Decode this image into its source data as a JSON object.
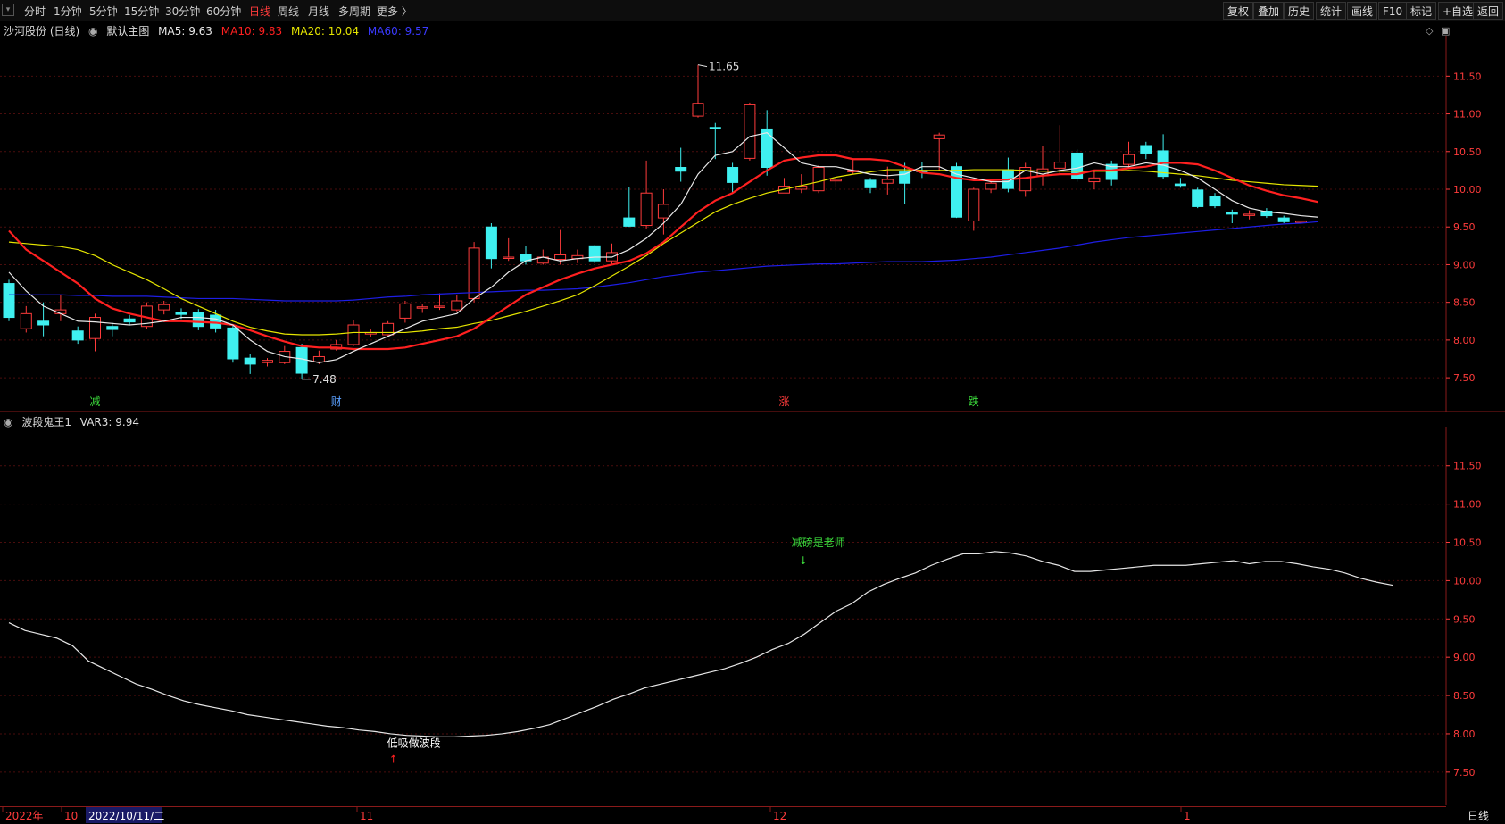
{
  "toolbar": {
    "periods": [
      "分时",
      "1分钟",
      "5分钟",
      "15分钟",
      "30分钟",
      "60分钟",
      "日线",
      "周线",
      "月线",
      "多周期",
      "更多 〉"
    ],
    "active_period": "日线",
    "actions": [
      "复权",
      "叠加",
      "历史",
      "统计",
      "画线",
      "F10",
      "标记",
      "+自选",
      "返回"
    ]
  },
  "main_legend": {
    "stock": "沙河股份 (日线)",
    "template": "默认主图",
    "ma5": "MA5: 9.63",
    "ma10": "MA10: 9.83",
    "ma20": "MA20: 10.04",
    "ma60": "MA60: 9.57"
  },
  "sub_legend": {
    "indicator": "波段鬼王1",
    "var3": "VAR3: 9.94"
  },
  "colors": {
    "up": "#ff3b3b",
    "down": "#3ff0f0",
    "ma5": "#e8e8e8",
    "ma10": "#ff2020",
    "ma20": "#e6e600",
    "ma60": "#1e1ee6",
    "axis": "#ff3b3b",
    "grid": "#4a0d0d"
  },
  "main_y_ticks": [
    "11.50",
    "11.00",
    "10.50",
    "10.00",
    "9.50",
    "9.00",
    "8.50",
    "8.00",
    "7.50"
  ],
  "sub_y_ticks": [
    "11.50",
    "11.00",
    "10.50",
    "10.00",
    "9.50",
    "9.00",
    "8.50",
    "8.00",
    "7.50"
  ],
  "annotations": {
    "high": "11.65",
    "low": "7.48"
  },
  "event_marks": [
    {
      "label": "减",
      "color": "#3cdc3c",
      "index": 5
    },
    {
      "label": "财",
      "color": "#5aa0ff",
      "index": 19
    },
    {
      "label": "涨",
      "color": "#ff3b3b",
      "index": 45
    },
    {
      "label": "跌",
      "color": "#3cdc3c",
      "index": 56
    }
  ],
  "sub_signals": {
    "buy": "低吸做波段",
    "sell": "减磅是老师"
  },
  "x_axis": {
    "year": "2022年",
    "m10": "10",
    "cursor_date": "2022/10/11/二",
    "m11": "11",
    "m12": "12",
    "m1": "1",
    "period": "日线"
  },
  "chart_data": {
    "type": "candlestick",
    "ylim": [
      7.3,
      11.8
    ],
    "candles": [
      [
        8.75,
        8.3,
        8.8,
        8.25
      ],
      [
        8.15,
        8.35,
        8.45,
        8.1
      ],
      [
        8.25,
        8.2,
        8.5,
        8.05
      ],
      [
        8.35,
        8.4,
        8.6,
        8.25
      ],
      [
        8.12,
        8.0,
        8.18,
        7.95
      ],
      [
        8.02,
        8.3,
        8.35,
        7.85
      ],
      [
        8.18,
        8.14,
        8.23,
        8.05
      ],
      [
        8.28,
        8.24,
        8.33,
        8.2
      ],
      [
        8.18,
        8.45,
        8.5,
        8.15
      ],
      [
        8.4,
        8.47,
        8.52,
        8.34
      ],
      [
        8.36,
        8.34,
        8.42,
        8.28
      ],
      [
        8.36,
        8.18,
        8.41,
        8.13
      ],
      [
        8.33,
        8.16,
        8.4,
        8.1
      ],
      [
        8.16,
        7.75,
        8.21,
        7.7
      ],
      [
        7.76,
        7.68,
        7.82,
        7.55
      ],
      [
        7.7,
        7.73,
        7.76,
        7.65
      ],
      [
        7.7,
        7.85,
        7.92,
        7.68
      ],
      [
        7.9,
        7.56,
        7.95,
        7.48
      ],
      [
        7.71,
        7.78,
        7.86,
        7.68
      ],
      [
        7.88,
        7.94,
        8.0,
        7.86
      ],
      [
        7.94,
        8.2,
        8.26,
        7.92
      ],
      [
        8.08,
        8.1,
        8.14,
        8.04
      ],
      [
        8.07,
        8.22,
        8.25,
        8.06
      ],
      [
        8.29,
        8.48,
        8.52,
        8.23
      ],
      [
        8.44,
        8.44,
        8.48,
        8.36
      ],
      [
        8.45,
        8.45,
        8.62,
        8.4
      ],
      [
        8.4,
        8.52,
        8.6,
        8.38
      ],
      [
        8.55,
        9.22,
        9.3,
        8.5
      ],
      [
        9.5,
        9.08,
        9.55,
        8.95
      ],
      [
        9.09,
        9.1,
        9.35,
        9.05
      ],
      [
        9.14,
        9.05,
        9.25,
        9.0
      ],
      [
        9.02,
        9.1,
        9.2,
        9.0
      ],
      [
        9.07,
        9.13,
        9.46,
        9.0
      ],
      [
        9.08,
        9.12,
        9.2,
        9.02
      ],
      [
        9.25,
        9.05,
        9.26,
        9.02
      ],
      [
        9.05,
        9.16,
        9.28,
        9.0
      ],
      [
        9.62,
        9.51,
        10.03,
        9.5
      ],
      [
        9.52,
        9.95,
        10.38,
        9.48
      ],
      [
        9.62,
        9.8,
        10.0,
        9.4
      ],
      [
        10.29,
        10.24,
        10.55,
        10.1
      ],
      [
        10.97,
        11.14,
        11.65,
        10.95
      ],
      [
        10.82,
        10.8,
        10.88,
        10.4
      ],
      [
        10.29,
        10.09,
        10.35,
        9.95
      ],
      [
        10.41,
        11.12,
        11.15,
        10.38
      ],
      [
        10.8,
        10.29,
        11.05,
        10.18
      ],
      [
        9.95,
        10.04,
        10.15,
        9.95
      ],
      [
        10.0,
        10.04,
        10.2,
        9.95
      ],
      [
        9.98,
        10.29,
        10.32,
        9.95
      ],
      [
        10.11,
        10.13,
        10.15,
        10.02
      ],
      [
        10.25,
        10.25,
        10.4,
        10.2
      ],
      [
        10.12,
        10.02,
        10.15,
        9.95
      ],
      [
        10.08,
        10.13,
        10.3,
        9.93
      ],
      [
        10.23,
        10.08,
        10.35,
        9.8
      ],
      [
        10.25,
        10.24,
        10.36,
        10.15
      ],
      [
        10.67,
        10.72,
        10.75,
        10.24
      ],
      [
        10.3,
        9.63,
        10.35,
        9.62
      ],
      [
        9.58,
        10.0,
        10.02,
        9.45
      ],
      [
        10.0,
        10.08,
        10.12,
        9.95
      ],
      [
        10.26,
        10.01,
        10.42,
        9.96
      ],
      [
        9.98,
        10.29,
        10.35,
        9.9
      ],
      [
        10.18,
        10.27,
        10.58,
        10.05
      ],
      [
        10.28,
        10.36,
        10.85,
        10.2
      ],
      [
        10.48,
        10.14,
        10.53,
        10.1
      ],
      [
        10.1,
        10.15,
        10.25,
        10.0
      ],
      [
        10.33,
        10.13,
        10.38,
        10.05
      ],
      [
        10.33,
        10.46,
        10.63,
        10.28
      ],
      [
        10.58,
        10.48,
        10.63,
        10.4
      ],
      [
        10.51,
        10.17,
        10.73,
        10.14
      ],
      [
        10.07,
        10.05,
        10.15,
        10.02
      ],
      [
        9.99,
        9.77,
        10.02,
        9.75
      ],
      [
        9.9,
        9.78,
        9.95,
        9.75
      ],
      [
        9.69,
        9.67,
        9.73,
        9.55
      ],
      [
        9.66,
        9.67,
        9.72,
        9.6
      ],
      [
        9.71,
        9.65,
        9.75,
        9.62
      ],
      [
        9.62,
        9.57,
        9.65,
        9.55
      ],
      [
        9.58,
        9.58,
        9.6,
        9.57
      ]
    ],
    "ma5": [
      8.9,
      8.65,
      8.45,
      8.35,
      8.25,
      8.24,
      8.22,
      8.2,
      8.22,
      8.25,
      8.3,
      8.3,
      8.28,
      8.2,
      8.0,
      7.85,
      7.78,
      7.75,
      7.7,
      7.74,
      7.85,
      7.95,
      8.05,
      8.15,
      8.25,
      8.3,
      8.35,
      8.55,
      8.7,
      8.9,
      9.05,
      9.1,
      9.05,
      9.08,
      9.1,
      9.1,
      9.2,
      9.35,
      9.55,
      9.8,
      10.2,
      10.45,
      10.5,
      10.7,
      10.75,
      10.55,
      10.35,
      10.3,
      10.3,
      10.25,
      10.2,
      10.18,
      10.2,
      10.3,
      10.3,
      10.2,
      10.15,
      10.1,
      10.1,
      10.25,
      10.2,
      10.25,
      10.28,
      10.35,
      10.3,
      10.3,
      10.35,
      10.32,
      10.25,
      10.15,
      10.0,
      9.85,
      9.75,
      9.7,
      9.68,
      9.65,
      9.63
    ],
    "ma10": [
      9.45,
      9.2,
      9.05,
      8.9,
      8.75,
      8.55,
      8.42,
      8.35,
      8.3,
      8.25,
      8.25,
      8.24,
      8.23,
      8.2,
      8.13,
      8.05,
      7.98,
      7.92,
      7.9,
      7.9,
      7.88,
      7.88,
      7.88,
      7.9,
      7.95,
      8.0,
      8.05,
      8.15,
      8.3,
      8.45,
      8.6,
      8.7,
      8.8,
      8.88,
      8.95,
      9.0,
      9.05,
      9.15,
      9.3,
      9.5,
      9.7,
      9.85,
      9.95,
      10.1,
      10.25,
      10.38,
      10.42,
      10.45,
      10.45,
      10.4,
      10.4,
      10.38,
      10.3,
      10.22,
      10.2,
      10.15,
      10.12,
      10.12,
      10.13,
      10.15,
      10.18,
      10.2,
      10.2,
      10.25,
      10.25,
      10.28,
      10.3,
      10.35,
      10.35,
      10.33,
      10.25,
      10.15,
      10.05,
      9.98,
      9.92,
      9.88,
      9.83
    ],
    "ma20": [
      9.3,
      9.28,
      9.26,
      9.24,
      9.2,
      9.12,
      9.0,
      8.9,
      8.8,
      8.68,
      8.55,
      8.45,
      8.35,
      8.25,
      8.17,
      8.12,
      8.08,
      8.07,
      8.07,
      8.08,
      8.1,
      8.1,
      8.1,
      8.1,
      8.12,
      8.15,
      8.17,
      8.22,
      8.26,
      8.32,
      8.38,
      8.45,
      8.52,
      8.6,
      8.72,
      8.85,
      8.98,
      9.12,
      9.28,
      9.42,
      9.56,
      9.7,
      9.8,
      9.88,
      9.95,
      10.0,
      10.05,
      10.1,
      10.16,
      10.2,
      10.23,
      10.26,
      10.26,
      10.25,
      10.25,
      10.25,
      10.26,
      10.26,
      10.26,
      10.25,
      10.24,
      10.24,
      10.24,
      10.24,
      10.24,
      10.25,
      10.24,
      10.22,
      10.2,
      10.18,
      10.15,
      10.12,
      10.1,
      10.08,
      10.06,
      10.05,
      10.04
    ],
    "ma60": [
      8.6,
      8.6,
      8.6,
      8.6,
      8.59,
      8.59,
      8.58,
      8.58,
      8.58,
      8.57,
      8.56,
      8.55,
      8.55,
      8.55,
      8.54,
      8.53,
      8.52,
      8.52,
      8.52,
      8.52,
      8.53,
      8.55,
      8.57,
      8.58,
      8.6,
      8.61,
      8.62,
      8.63,
      8.64,
      8.65,
      8.66,
      8.66,
      8.67,
      8.68,
      8.7,
      8.73,
      8.76,
      8.8,
      8.84,
      8.87,
      8.9,
      8.92,
      8.94,
      8.96,
      8.98,
      8.99,
      9.0,
      9.01,
      9.01,
      9.02,
      9.03,
      9.04,
      9.04,
      9.04,
      9.05,
      9.06,
      9.08,
      9.1,
      9.13,
      9.16,
      9.19,
      9.22,
      9.26,
      9.3,
      9.33,
      9.36,
      9.38,
      9.4,
      9.42,
      9.44,
      9.46,
      9.48,
      9.5,
      9.52,
      9.54,
      9.55,
      9.57
    ],
    "var3": [
      9.45,
      9.35,
      9.3,
      9.25,
      9.15,
      8.95,
      8.85,
      8.75,
      8.65,
      8.58,
      8.5,
      8.43,
      8.38,
      8.34,
      8.3,
      8.25,
      8.22,
      8.19,
      8.16,
      8.13,
      8.1,
      8.08,
      8.05,
      8.03,
      8.0,
      7.98,
      7.97,
      7.96,
      7.96,
      7.97,
      7.98,
      8.0,
      8.03,
      8.07,
      8.12,
      8.2,
      8.28,
      8.36,
      8.45,
      8.52,
      8.6,
      8.65,
      8.7,
      8.75,
      8.8,
      8.85,
      8.92,
      9.0,
      9.1,
      9.18,
      9.3,
      9.45,
      9.6,
      9.7,
      9.85,
      9.95,
      10.03,
      10.1,
      10.2,
      10.28,
      10.35,
      10.35,
      10.38,
      10.36,
      10.32,
      10.25,
      10.2,
      10.12,
      10.12,
      10.14,
      10.16,
      10.18,
      10.2,
      10.2,
      10.2,
      10.22,
      10.24,
      10.26,
      10.22,
      10.25,
      10.25,
      10.22,
      10.18,
      10.15,
      10.1,
      10.03,
      9.98,
      9.94
    ]
  }
}
